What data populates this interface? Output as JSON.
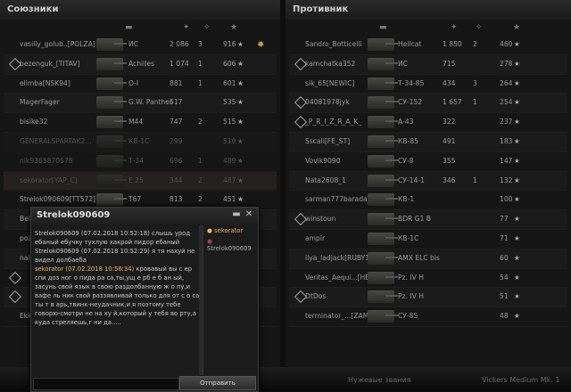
{
  "left": {
    "title": "Союзники",
    "rows": [
      {
        "name": "vasiliy_golub..[POLZA]",
        "tank": "ИС",
        "dmg": "2 086",
        "frags": "3",
        "xp": "916",
        "mark": false,
        "medal": true,
        "dead": false,
        "hl": false
      },
      {
        "name": "bezenguk_[TITAV]",
        "tank": "Achilles",
        "dmg": "1 074",
        "frags": "1",
        "xp": "606",
        "mark": true,
        "medal": false,
        "dead": false,
        "hl": false
      },
      {
        "name": "elimba[NSK94]",
        "tank": "O-I",
        "dmg": "881",
        "frags": "1",
        "xp": "601",
        "mark": false,
        "medal": false,
        "dead": false,
        "hl": false
      },
      {
        "name": "MagerFager",
        "tank": "G.W. Panther",
        "dmg": "517",
        "frags": "",
        "xp": "535",
        "mark": false,
        "medal": false,
        "dead": false,
        "hl": false
      },
      {
        "name": "bisike32",
        "tank": "M44",
        "dmg": "747",
        "frags": "2",
        "xp": "515",
        "mark": false,
        "medal": false,
        "dead": false,
        "hl": false
      },
      {
        "name": "GENERALSPARTAK2...",
        "tank": "КВ-1С",
        "dmg": "299",
        "frags": "",
        "xp": "510",
        "mark": false,
        "medal": false,
        "dead": true,
        "hl": false
      },
      {
        "name": "nik9365870578",
        "tank": "Т-34",
        "dmg": "696",
        "frags": "1",
        "xp": "489",
        "mark": false,
        "medal": false,
        "dead": true,
        "hl": false
      },
      {
        "name": "sekorator[YAP_C]",
        "tank": "E 25",
        "dmg": "344",
        "frags": "2",
        "xp": "487",
        "mark": false,
        "medal": false,
        "dead": true,
        "hl": true
      },
      {
        "name": "Strelok090609[TT572]",
        "tank": "T67",
        "dmg": "813",
        "frags": "2",
        "xp": "451",
        "mark": false,
        "medal": false,
        "dead": false,
        "hl": false
      },
      {
        "name": "Bel",
        "tank": "",
        "dmg": "",
        "frags": "",
        "xp": "",
        "mark": false,
        "medal": false,
        "dead": false,
        "hl": false
      },
      {
        "name": "poz",
        "tank": "",
        "dmg": "",
        "frags": "",
        "xp": "",
        "mark": false,
        "medal": false,
        "dead": false,
        "hl": false
      },
      {
        "name": "nai",
        "tank": "",
        "dmg": "",
        "frags": "",
        "xp": "",
        "mark": false,
        "medal": false,
        "dead": false,
        "hl": false
      },
      {
        "name": "",
        "tank": "",
        "dmg": "",
        "frags": "",
        "xp": "",
        "mark": true,
        "medal": false,
        "dead": false,
        "hl": false
      },
      {
        "name": "",
        "tank": "",
        "dmg": "",
        "frags": "",
        "xp": "",
        "mark": true,
        "medal": false,
        "dead": false,
        "hl": false
      },
      {
        "name": "Ekk",
        "tank": "",
        "dmg": "",
        "frags": "",
        "xp": "",
        "mark": false,
        "medal": false,
        "dead": false,
        "hl": false
      }
    ]
  },
  "right": {
    "title": "Противник",
    "rows": [
      {
        "name": "Sandro_Botticelli",
        "tank": "Hellcat",
        "dmg": "1 850",
        "frags": "2",
        "xp": "460",
        "mark": false
      },
      {
        "name": "kamchatka352",
        "tank": "ИС",
        "dmg": "715",
        "frags": "",
        "xp": "278",
        "mark": true
      },
      {
        "name": "sik_65[NEWIC]",
        "tank": "Т-34-85",
        "dmg": "434",
        "frags": "3",
        "xp": "264",
        "mark": false
      },
      {
        "name": "04081978jyk",
        "tank": "СУ-152",
        "dmg": "1 657",
        "frags": "1",
        "xp": "254",
        "mark": true
      },
      {
        "name": "_P_R_I_Z_R_A_K_",
        "tank": "А-43",
        "dmg": "322",
        "frags": "",
        "xp": "237",
        "mark": true
      },
      {
        "name": "Sscali[FE_ST]",
        "tank": "КВ-85",
        "dmg": "491",
        "frags": "",
        "xp": "183",
        "mark": false
      },
      {
        "name": "Vovik9090",
        "tank": "СУ-8",
        "dmg": "355",
        "frags": "",
        "xp": "147",
        "mark": false
      },
      {
        "name": "Nata2608_1",
        "tank": "СУ-14-1",
        "dmg": "346",
        "frags": "1",
        "xp": "132",
        "mark": false
      },
      {
        "name": "sarman777barada",
        "tank": "КВ-1",
        "dmg": "",
        "frags": "",
        "xp": "100",
        "mark": false
      },
      {
        "name": "winstoun",
        "tank": "BDR G1 B",
        "dmg": "",
        "frags": "",
        "xp": "77",
        "mark": true
      },
      {
        "name": "ampir",
        "tank": "КВ-1С",
        "dmg": "",
        "frags": "",
        "xp": "71",
        "mark": false
      },
      {
        "name": "ilya_ladjack[RUBY1]",
        "tank": "AMX ELC bis",
        "dmg": "",
        "frags": "",
        "xp": "60",
        "mark": false
      },
      {
        "name": "Veritas_Aequi...[HE_D]",
        "tank": "Pz. IV H",
        "dmg": "",
        "frags": "",
        "xp": "54",
        "mark": false
      },
      {
        "name": "DtDos",
        "tank": "Pz. IV H",
        "dmg": "",
        "frags": "",
        "xp": "51",
        "mark": true
      },
      {
        "name": "terminator_...[ZAMBA]",
        "tank": "СУ-85",
        "dmg": "",
        "frags": "",
        "xp": "48",
        "mark": false
      }
    ]
  },
  "chat": {
    "title": "Strelok090609",
    "messages": [
      {
        "sender": "Strelok090609",
        "time": "(07.02.2018 10:52:18)",
        "text": "слышь урод ебаный ебучку тухлую хакрой пидор ебаный",
        "own": false
      },
      {
        "sender": "Strelok090609",
        "time": "(07.02.2018 10:52:29)",
        "text": "я тя нахуй не видел долбаеба",
        "own": false
      },
      {
        "sender": "sekorator",
        "time": "(07.02.2018 10:56:34)",
        "text": "кровавый вы с ер спи доз ног о пида ра са,ты,ущ е рб е б ан ый, засунь свой язык в свою раздолбанную ж о пу,и вафе ль ник свой раззявливай только для от с о са. ты т в арь,твинк-неудачник,и я поэтому тебе говорю-смотри не на ху й,который у тебя во рту,а куда стреляешь,г ни да.....",
        "own": true
      }
    ],
    "users": [
      "sekorator",
      "Strelok090609"
    ],
    "send_label": "Отправить",
    "minimize": "▬",
    "close": "✕"
  },
  "bottom": {
    "items": [
      "Нужевые звания",
      "Vickers Medium Mk. 1"
    ]
  }
}
